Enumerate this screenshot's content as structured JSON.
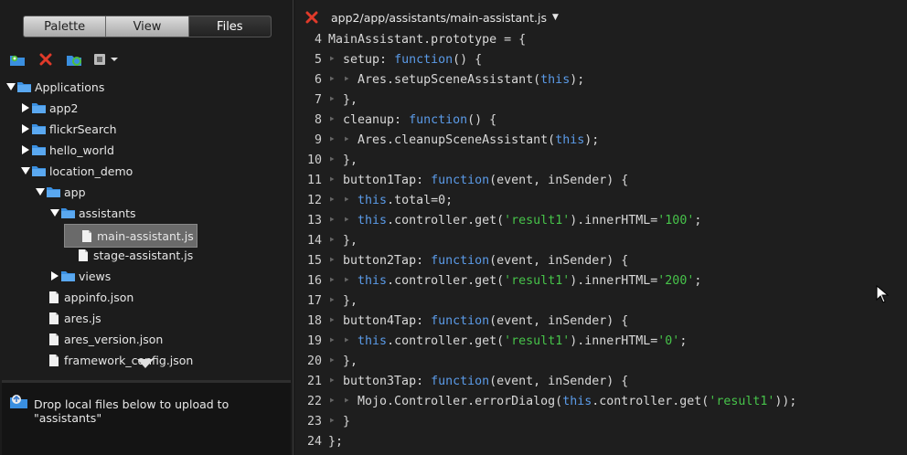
{
  "sidebar": {
    "tabs": [
      "Palette",
      "View",
      "Files"
    ],
    "active_tab": "Files",
    "toolbar_icons": [
      "new-folder-icon",
      "delete-icon",
      "refresh-icon",
      "actions-menu-icon"
    ],
    "tree": [
      {
        "label": "Applications",
        "depth": 0,
        "type": "folder",
        "expanded": true
      },
      {
        "label": "app2",
        "depth": 1,
        "type": "folder",
        "expanded": false
      },
      {
        "label": "flickrSearch",
        "depth": 1,
        "type": "folder",
        "expanded": false
      },
      {
        "label": "hello_world",
        "depth": 1,
        "type": "folder",
        "expanded": false
      },
      {
        "label": "location_demo",
        "depth": 1,
        "type": "folder",
        "expanded": true
      },
      {
        "label": "app",
        "depth": 2,
        "type": "folder",
        "expanded": true
      },
      {
        "label": "assistants",
        "depth": 3,
        "type": "folder",
        "expanded": true
      },
      {
        "label": "main-assistant.js",
        "depth": 4,
        "type": "file",
        "selected": true
      },
      {
        "label": "stage-assistant.js",
        "depth": 4,
        "type": "file"
      },
      {
        "label": "views",
        "depth": 3,
        "type": "folder",
        "expanded": false
      },
      {
        "label": "appinfo.json",
        "depth": 2,
        "type": "file"
      },
      {
        "label": "ares.js",
        "depth": 2,
        "type": "file"
      },
      {
        "label": "ares_version.json",
        "depth": 2,
        "type": "file"
      },
      {
        "label": "framework_config.json",
        "depth": 2,
        "type": "file"
      }
    ],
    "drop_zone": "Drop local files below to upload to \"assistants\""
  },
  "editor": {
    "file_path": "app2/app/assistants/main-assistant.js",
    "lines": [
      {
        "num": "4",
        "indent": 0,
        "tokens": [
          [
            "t",
            "MainAssistant.prototype = {"
          ]
        ]
      },
      {
        "num": "5",
        "indent": 1,
        "tokens": [
          [
            "t",
            "setup: "
          ],
          [
            "k",
            "function"
          ],
          [
            "t",
            "() {"
          ]
        ]
      },
      {
        "num": "6",
        "indent": 2,
        "tokens": [
          [
            "t",
            "Ares.setupSceneAssistant("
          ],
          [
            "k",
            "this"
          ],
          [
            "t",
            ");"
          ]
        ]
      },
      {
        "num": "7",
        "indent": 1,
        "tokens": [
          [
            "t",
            "},"
          ]
        ]
      },
      {
        "num": "8",
        "indent": 1,
        "tokens": [
          [
            "t",
            "cleanup: "
          ],
          [
            "k",
            "function"
          ],
          [
            "t",
            "() {"
          ]
        ]
      },
      {
        "num": "9",
        "indent": 2,
        "tokens": [
          [
            "t",
            "Ares.cleanupSceneAssistant("
          ],
          [
            "k",
            "this"
          ],
          [
            "t",
            ");"
          ]
        ]
      },
      {
        "num": "10",
        "indent": 1,
        "tokens": [
          [
            "t",
            "},"
          ]
        ]
      },
      {
        "num": "11",
        "indent": 1,
        "tokens": [
          [
            "t",
            "button1Tap: "
          ],
          [
            "k",
            "function"
          ],
          [
            "t",
            "(event, inSender) {"
          ]
        ]
      },
      {
        "num": "12",
        "indent": 2,
        "tokens": [
          [
            "k",
            "this"
          ],
          [
            "t",
            ".total=0;"
          ]
        ]
      },
      {
        "num": "13",
        "indent": 2,
        "tokens": [
          [
            "k",
            "this"
          ],
          [
            "t",
            ".controller.get("
          ],
          [
            "s",
            "'result1'"
          ],
          [
            "t",
            ").innerHTML="
          ],
          [
            "s",
            "'100'"
          ],
          [
            "t",
            ";"
          ]
        ]
      },
      {
        "num": "14",
        "indent": 1,
        "tokens": [
          [
            "t",
            "},"
          ]
        ]
      },
      {
        "num": "15",
        "indent": 1,
        "tokens": [
          [
            "t",
            "button2Tap: "
          ],
          [
            "k",
            "function"
          ],
          [
            "t",
            "(event, inSender) {"
          ]
        ]
      },
      {
        "num": "16",
        "indent": 2,
        "tokens": [
          [
            "k",
            "this"
          ],
          [
            "t",
            ".controller.get("
          ],
          [
            "s",
            "'result1'"
          ],
          [
            "t",
            ").innerHTML="
          ],
          [
            "s",
            "'200'"
          ],
          [
            "t",
            ";"
          ]
        ]
      },
      {
        "num": "17",
        "indent": 1,
        "tokens": [
          [
            "t",
            "},"
          ]
        ]
      },
      {
        "num": "18",
        "indent": 1,
        "tokens": [
          [
            "t",
            "button4Tap: "
          ],
          [
            "k",
            "function"
          ],
          [
            "t",
            "(event, inSender) {"
          ]
        ]
      },
      {
        "num": "19",
        "indent": 2,
        "tokens": [
          [
            "k",
            "this"
          ],
          [
            "t",
            ".controller.get("
          ],
          [
            "s",
            "'result1'"
          ],
          [
            "t",
            ").innerHTML="
          ],
          [
            "s",
            "'0'"
          ],
          [
            "t",
            ";"
          ]
        ]
      },
      {
        "num": "20",
        "indent": 1,
        "tokens": [
          [
            "t",
            "},"
          ]
        ]
      },
      {
        "num": "21",
        "indent": 1,
        "tokens": [
          [
            "t",
            "button3Tap: "
          ],
          [
            "k",
            "function"
          ],
          [
            "t",
            "(event, inSender) {"
          ]
        ]
      },
      {
        "num": "22",
        "indent": 2,
        "tokens": [
          [
            "t",
            "Mojo.Controller.errorDialog("
          ],
          [
            "k",
            "this"
          ],
          [
            "t",
            ".controller.get("
          ],
          [
            "s",
            "'result1'"
          ],
          [
            "t",
            "));"
          ]
        ]
      },
      {
        "num": "23",
        "indent": 1,
        "tokens": [
          [
            "t",
            "}"
          ]
        ]
      },
      {
        "num": "24",
        "indent": 0,
        "tokens": [
          [
            "t",
            "};"
          ]
        ]
      }
    ]
  },
  "colors": {
    "keyword": "#5b9be8",
    "string": "#47c34a",
    "folder": "#3a8fe0"
  }
}
